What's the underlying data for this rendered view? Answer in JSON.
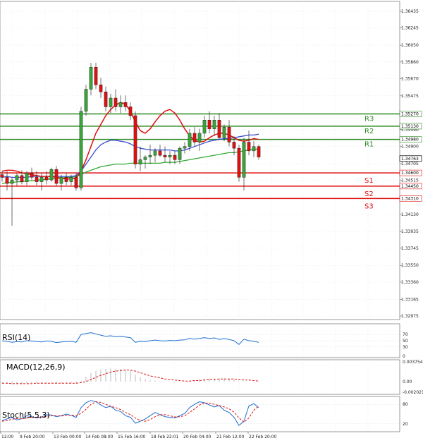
{
  "colors": {
    "resistance": "#2e8b22",
    "support": "#e01010",
    "ema_red": "#e01010",
    "ma_blue": "#3a4fd1",
    "ma_green": "#33aa33",
    "candle_up": "#3aa63a",
    "candle_down": "#e01010",
    "indicator_blue": "#1f6fd0",
    "indicator_red": "#e01010",
    "grid": "#d7e3ef",
    "axis": "#555555",
    "price_tag_bg": "#ffffff"
  },
  "chart_data": [
    {
      "type": "candlestick",
      "title": "",
      "ylim": [
        1.32975,
        1.36435
      ],
      "y_ticks": [
        "1.36435",
        "1.36245",
        "1.36050",
        "1.35860",
        "1.35670",
        "1.35475",
        "1.35090",
        "1.34900",
        "1.34705",
        "1.34515",
        "1.34130",
        "1.33935",
        "1.33745",
        "1.33550",
        "1.33360",
        "1.33165",
        "1.32975"
      ],
      "current_price": "1.34763",
      "levels": [
        {
          "label": "R3",
          "value": "1.35270",
          "kind": "resistance"
        },
        {
          "label": "R2",
          "value": "1.35130",
          "kind": "resistance"
        },
        {
          "label": "R1",
          "value": "1.34980",
          "kind": "resistance"
        },
        {
          "label": "S1",
          "value": "1.34600",
          "kind": "support"
        },
        {
          "label": "S2",
          "value": "1.34450",
          "kind": "support"
        },
        {
          "label": "S3",
          "value": "1.34310",
          "kind": "support"
        }
      ],
      "candles": [
        [
          1.3458,
          1.3462,
          1.345,
          1.3455
        ],
        [
          1.3455,
          1.3462,
          1.344,
          1.3448
        ],
        [
          1.3448,
          1.3455,
          1.34,
          1.3452
        ],
        [
          1.3452,
          1.346,
          1.3445,
          1.3457
        ],
        [
          1.3457,
          1.3463,
          1.3447,
          1.345
        ],
        [
          1.345,
          1.3462,
          1.3446,
          1.346
        ],
        [
          1.346,
          1.3466,
          1.3452,
          1.3455
        ],
        [
          1.3455,
          1.3462,
          1.3446,
          1.345
        ],
        [
          1.345,
          1.346,
          1.344,
          1.3455
        ],
        [
          1.3455,
          1.3462,
          1.3447,
          1.3452
        ],
        [
          1.3452,
          1.3466,
          1.345,
          1.3464
        ],
        [
          1.3464,
          1.3468,
          1.3445,
          1.3448
        ],
        [
          1.3448,
          1.3458,
          1.344,
          1.3455
        ],
        [
          1.3455,
          1.346,
          1.3446,
          1.345
        ],
        [
          1.345,
          1.3458,
          1.3446,
          1.3455
        ],
        [
          1.3455,
          1.346,
          1.344,
          1.3443
        ],
        [
          1.3443,
          1.3535,
          1.344,
          1.353
        ],
        [
          1.353,
          1.356,
          1.3525,
          1.3555
        ],
        [
          1.3555,
          1.3585,
          1.3548,
          1.358
        ],
        [
          1.358,
          1.3585,
          1.3555,
          1.356
        ],
        [
          1.356,
          1.3568,
          1.3545,
          1.3552
        ],
        [
          1.3552,
          1.3558,
          1.353,
          1.3535
        ],
        [
          1.3535,
          1.355,
          1.3528,
          1.3545
        ],
        [
          1.3545,
          1.3555,
          1.353,
          1.3535
        ],
        [
          1.3535,
          1.3548,
          1.3528,
          1.354
        ],
        [
          1.354,
          1.3548,
          1.353,
          1.3535
        ],
        [
          1.3535,
          1.354,
          1.352,
          1.3525
        ],
        [
          1.3525,
          1.353,
          1.3465,
          1.347
        ],
        [
          1.347,
          1.349,
          1.3462,
          1.3475
        ],
        [
          1.3475,
          1.348,
          1.3465,
          1.3478
        ],
        [
          1.3478,
          1.3492,
          1.347,
          1.348
        ],
        [
          1.348,
          1.3488,
          1.3472,
          1.3485
        ],
        [
          1.3485,
          1.3492,
          1.3478,
          1.348
        ],
        [
          1.348,
          1.349,
          1.3472,
          1.3478
        ],
        [
          1.3478,
          1.3485,
          1.347,
          1.348
        ],
        [
          1.348,
          1.3485,
          1.347,
          1.3475
        ],
        [
          1.3475,
          1.349,
          1.347,
          1.3488
        ],
        [
          1.3488,
          1.3495,
          1.3482,
          1.349
        ],
        [
          1.349,
          1.351,
          1.3485,
          1.3505
        ],
        [
          1.3505,
          1.3512,
          1.349,
          1.3495
        ],
        [
          1.3495,
          1.351,
          1.3485,
          1.3505
        ],
        [
          1.3505,
          1.3525,
          1.35,
          1.352
        ],
        [
          1.352,
          1.353,
          1.3505,
          1.351
        ],
        [
          1.351,
          1.3525,
          1.3502,
          1.352
        ],
        [
          1.352,
          1.3528,
          1.3498,
          1.35
        ],
        [
          1.35,
          1.3515,
          1.3496,
          1.3512
        ],
        [
          1.3512,
          1.352,
          1.349,
          1.3495
        ],
        [
          1.3495,
          1.3502,
          1.348,
          1.3488
        ],
        [
          1.3488,
          1.3492,
          1.345,
          1.3455
        ],
        [
          1.3455,
          1.35,
          1.344,
          1.3495
        ],
        [
          1.3495,
          1.3508,
          1.348,
          1.3485
        ],
        [
          1.3485,
          1.3496,
          1.3478,
          1.349
        ],
        [
          1.349,
          1.3492,
          1.3475,
          1.3478
        ]
      ]
    },
    {
      "type": "line",
      "title": "RSI(14)",
      "ylim": [
        0,
        100
      ],
      "y_ticks": [
        "70",
        "50",
        "30",
        "0"
      ],
      "series": [
        {
          "values": [
            50,
            48,
            45,
            47,
            46,
            50,
            49,
            47,
            46,
            49,
            48,
            44,
            46,
            47,
            48,
            45,
            70,
            73,
            76,
            72,
            68,
            64,
            66,
            63,
            64,
            62,
            60,
            45,
            48,
            47,
            50,
            52,
            50,
            49,
            51,
            50,
            52,
            53,
            57,
            55,
            57,
            60,
            57,
            59,
            54,
            57,
            54,
            50,
            38,
            55,
            50,
            48,
            45
          ]
        }
      ]
    },
    {
      "type": "bar",
      "title": "MACD(12,26,9)",
      "ylim": [
        -0.002021,
        0.003754
      ],
      "y_ticks": [
        "0.003754",
        "0.00",
        "-0.002021"
      ],
      "values": [
        -0.0003,
        -0.0004,
        -0.0005,
        -0.0004,
        -0.0004,
        -0.0003,
        -0.0003,
        -0.0003,
        -0.0003,
        -0.0003,
        -0.0002,
        -0.0003,
        -0.0003,
        -0.0003,
        -0.0003,
        -0.0004,
        0.0002,
        0.0009,
        0.0016,
        0.002,
        0.0023,
        0.0024,
        0.0025,
        0.0024,
        0.0024,
        0.0023,
        0.0021,
        0.0013,
        0.0008,
        0.0005,
        0.0003,
        0.0002,
        0.0001,
        0.0,
        -0.0001,
        -0.0001,
        -0.0001,
        0.0,
        0.0002,
        0.0003,
        0.0004,
        0.0005,
        0.0006,
        0.0006,
        0.0006,
        0.0006,
        0.0005,
        0.0004,
        0.0001,
        0.0001,
        0.0,
        -0.0001,
        -0.0001
      ],
      "signal": [
        -0.0003,
        -0.0003,
        -0.0004,
        -0.0004,
        -0.0004,
        -0.0004,
        -0.0004,
        -0.0003,
        -0.0003,
        -0.0003,
        -0.0003,
        -0.0003,
        -0.0003,
        -0.0003,
        -0.0003,
        -0.0003,
        -0.0002,
        0.0,
        0.0004,
        0.0008,
        0.0012,
        0.0015,
        0.0018,
        0.002,
        0.0021,
        0.0022,
        0.0022,
        0.002,
        0.0017,
        0.0014,
        0.0011,
        0.0009,
        0.0007,
        0.0005,
        0.0004,
        0.0003,
        0.0002,
        0.0001,
        0.0001,
        0.0002,
        0.0002,
        0.0003,
        0.0004,
        0.0004,
        0.0005,
        0.0005,
        0.0005,
        0.0005,
        0.0004,
        0.0003,
        0.0003,
        0.0002,
        0.0001
      ]
    },
    {
      "type": "line",
      "title": "Stoch(5,5,3)",
      "ylim": [
        0,
        100
      ],
      "y_ticks": [
        "80",
        "20"
      ],
      "series": [
        {
          "values": [
            30,
            35,
            40,
            32,
            36,
            45,
            42,
            38,
            41,
            48,
            47,
            42,
            45,
            50,
            46,
            40,
            70,
            85,
            92,
            88,
            78,
            70,
            74,
            62,
            58,
            45,
            40,
            22,
            28,
            35,
            45,
            55,
            48,
            42,
            40,
            38,
            45,
            52,
            70,
            80,
            88,
            85,
            78,
            72,
            76,
            62,
            55,
            40,
            15,
            28,
            75,
            82,
            70
          ]
        },
        {
          "values": [
            28,
            30,
            34,
            36,
            35,
            38,
            40,
            40,
            41,
            43,
            45,
            45,
            44,
            46,
            47,
            45,
            52,
            65,
            80,
            88,
            86,
            80,
            74,
            70,
            64,
            55,
            48,
            38,
            30,
            28,
            33,
            42,
            48,
            48,
            45,
            41,
            42,
            45,
            55,
            66,
            78,
            84,
            84,
            80,
            76,
            72,
            66,
            56,
            38,
            25,
            38,
            62,
            75
          ]
        }
      ]
    }
  ],
  "x_axis_labels": [
    "12:00",
    "9 Feb 20:00",
    "13 Feb 00:00",
    "14 Feb 08:00",
    "15 Feb 16:00",
    "18 Feb 22:01",
    "20 Feb 04:00",
    "21 Feb 12:00",
    "22 Feb 20:00"
  ],
  "overlay_series": {
    "ema_red": [
      1.3462,
      1.3463,
      1.3463,
      1.3462,
      1.346,
      1.3459,
      1.3458,
      1.3457,
      1.3456,
      1.3456,
      1.3456,
      1.3455,
      1.3454,
      1.3453,
      1.3453,
      1.3454,
      1.3462,
      1.3475,
      1.349,
      1.3505,
      1.3515,
      1.3525,
      1.3532,
      1.3537,
      1.354,
      1.3538,
      1.353,
      1.3518,
      1.3508,
      1.3505,
      1.351,
      1.3518,
      1.3525,
      1.353,
      1.3532,
      1.3528,
      1.352,
      1.351,
      1.3502,
      1.3497,
      1.3495,
      1.3496,
      1.35,
      1.3503,
      1.3505,
      1.3505,
      1.3503,
      1.35,
      1.3497,
      1.3496,
      1.3497,
      1.3499,
      1.3498
    ],
    "ma_blue": [
      1.3455,
      1.3456,
      1.3455,
      1.3455,
      1.3455,
      1.3455,
      1.3456,
      1.3456,
      1.3456,
      1.3456,
      1.3456,
      1.3456,
      1.3456,
      1.3456,
      1.3456,
      1.3457,
      1.3462,
      1.347,
      1.3478,
      1.3486,
      1.3492,
      1.3495,
      1.3497,
      1.3497,
      1.3496,
      1.3495,
      1.3493,
      1.349,
      1.3488,
      1.3487,
      1.3486,
      1.3486,
      1.3486,
      1.3486,
      1.3486,
      1.3485,
      1.3485,
      1.3486,
      1.3488,
      1.349,
      1.3492,
      1.3494,
      1.3496,
      1.3497,
      1.3498,
      1.3499,
      1.3499,
      1.35,
      1.3501,
      1.3502,
      1.3503,
      1.3503,
      1.3504
    ],
    "ma_green": [
      1.3448,
      1.3449,
      1.3449,
      1.345,
      1.345,
      1.3451,
      1.3451,
      1.3452,
      1.3452,
      1.3453,
      1.3453,
      1.3454,
      1.3454,
      1.3455,
      1.3455,
      1.3456,
      1.3458,
      1.3461,
      1.3463,
      1.3465,
      1.3467,
      1.3468,
      1.3469,
      1.347,
      1.347,
      1.347,
      1.3471,
      1.3471,
      1.3471,
      1.3471,
      1.3471,
      1.3471,
      1.3471,
      1.3472,
      1.3472,
      1.3472,
      1.3473,
      1.3474,
      1.3475,
      1.3476,
      1.3477,
      1.3478,
      1.3479,
      1.348,
      1.3481,
      1.3482,
      1.3483,
      1.3483,
      1.3484,
      1.3485,
      1.3486,
      1.3487,
      1.3487
    ]
  }
}
